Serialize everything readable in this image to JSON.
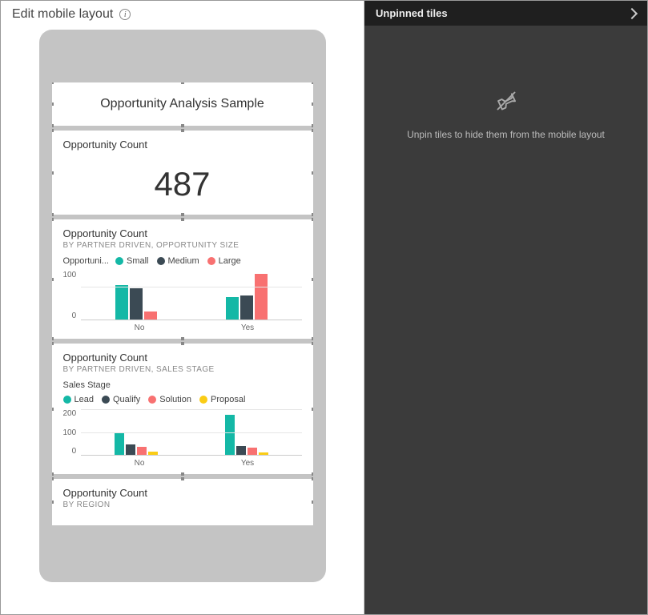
{
  "header": {
    "title": "Edit mobile layout"
  },
  "phone": {
    "dashboard_title": "Opportunity Analysis Sample"
  },
  "tiles": {
    "count_card": {
      "title": "Opportunity Count",
      "value": "487"
    },
    "chart1": {
      "title": "Opportunity Count",
      "subtitle": "BY PARTNER DRIVEN, OPPORTUNITY SIZE",
      "legend_title": "Opportuni..."
    },
    "chart2": {
      "title": "Opportunity Count",
      "subtitle": "BY PARTNER DRIVEN, SALES STAGE",
      "legend_title": "Sales Stage"
    },
    "chart3": {
      "title": "Opportunity Count",
      "subtitle": "BY REGION"
    }
  },
  "right": {
    "header": "Unpinned tiles",
    "hint": "Unpin tiles to hide them from the mobile layout"
  },
  "colors": {
    "teal": "#14b8a6",
    "dark": "#3b4a54",
    "coral": "#f87171",
    "yellow": "#facc15"
  },
  "chart_data": [
    {
      "id": "chart1",
      "type": "bar",
      "title": "Opportunity Count",
      "subtitle": "BY PARTNER DRIVEN, OPPORTUNITY SIZE",
      "xlabel": "",
      "ylabel": "",
      "ylim": [
        0,
        150
      ],
      "y_ticks": [
        100,
        0
      ],
      "categories": [
        "No",
        "Yes"
      ],
      "series": [
        {
          "name": "Small",
          "color": "#14b8a6",
          "values": [
            105,
            70
          ]
        },
        {
          "name": "Medium",
          "color": "#3b4a54",
          "values": [
            95,
            75
          ]
        },
        {
          "name": "Large",
          "color": "#f87171",
          "values": [
            25,
            140
          ]
        }
      ]
    },
    {
      "id": "chart2",
      "type": "bar",
      "title": "Opportunity Count",
      "subtitle": "BY PARTNER DRIVEN, SALES STAGE",
      "xlabel": "",
      "ylabel": "",
      "ylim": [
        0,
        200
      ],
      "y_ticks": [
        200,
        100,
        0
      ],
      "categories": [
        "No",
        "Yes"
      ],
      "series": [
        {
          "name": "Lead",
          "color": "#14b8a6",
          "values": [
            100,
            175
          ]
        },
        {
          "name": "Qualify",
          "color": "#3b4a54",
          "values": [
            45,
            40
          ]
        },
        {
          "name": "Solution",
          "color": "#f87171",
          "values": [
            35,
            30
          ]
        },
        {
          "name": "Proposal",
          "color": "#facc15",
          "values": [
            15,
            10
          ]
        }
      ]
    }
  ]
}
